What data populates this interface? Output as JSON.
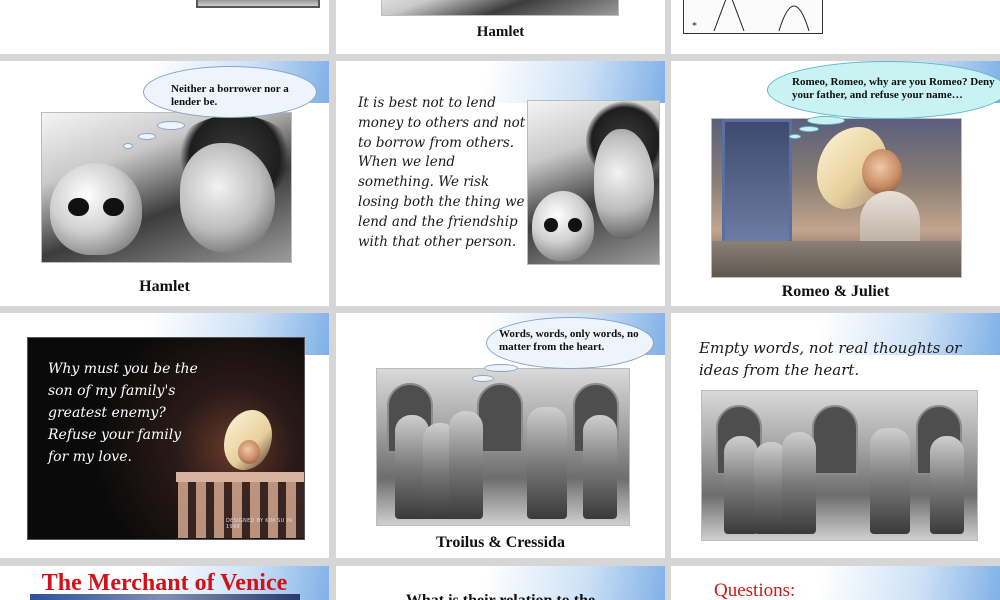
{
  "row0": {
    "middle_caption": "Hamlet"
  },
  "hamlet_slide": {
    "thought": "Neither a borrower nor a lender be.",
    "caption": "Hamlet"
  },
  "advice_slide": {
    "text": "It is best not to lend money to others and not to borrow from others. When we lend something. We risk losing both the thing we lend and the friendship with that other person."
  },
  "romeo_slide": {
    "thought": "Romeo, Romeo, why are you Romeo? Deny your father, and refuse your name…",
    "caption": "Romeo & Juliet"
  },
  "enemy_slide": {
    "text": "Why must you be the son of my family's greatest enemy? Refuse your family for my love.",
    "credit": "DESIGNED BY KIM SU IN 1999"
  },
  "troilus_slide": {
    "thought": "Words, words, only words, no matter from the heart.",
    "caption": "Troilus & Cressida"
  },
  "empty_words_slide": {
    "text": "Empty words, not real thoughts or ideas from the heart."
  },
  "merchant_slide": {
    "title": "The Merchant of Venice"
  },
  "relation_slide": {
    "text": "What is their relation to the"
  },
  "questions_slide": {
    "title": "Questions:"
  }
}
